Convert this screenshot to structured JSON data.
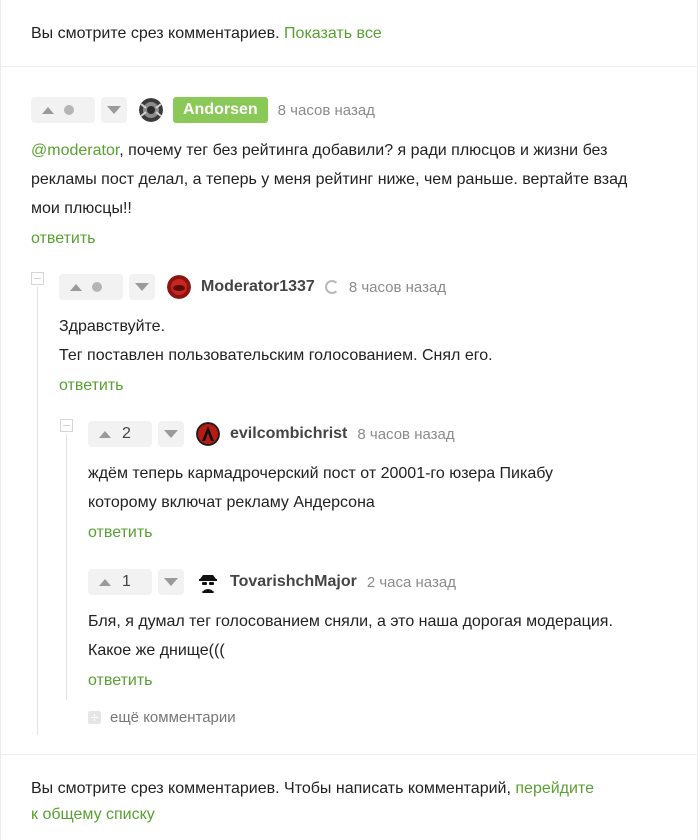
{
  "top_banner": {
    "text": "Вы смотрите срез комментариев.",
    "link": "Показать все"
  },
  "comments": [
    {
      "vote_count": "",
      "username": "Andorsen",
      "time": "8 часов назад",
      "mention": "@moderator",
      "lines": [
        ", почему тег без рейтинга добавили? я ради плюсцов и жизни без",
        "рекламы пост делал, а теперь у меня рейтинг ниже, чем раньше. вертайте взад",
        "мои плюсцы!!"
      ],
      "reply": "ответить"
    },
    {
      "vote_count": "",
      "username": "Moderator1337",
      "time": "8 часов назад",
      "lines": [
        "Здравствуйте.",
        "Тег поставлен пользовательским голосованием. Снял его."
      ],
      "reply": "ответить"
    },
    {
      "vote_count": "2",
      "username": "evilcombichrist",
      "time": "8 часов назад",
      "lines": [
        "ждём теперь кармадрочерский пост от 20001-го юзера Пикабу",
        "которому включат рекламу Андерсона"
      ],
      "reply": "ответить"
    },
    {
      "vote_count": "1",
      "username": "TovarishchMajor",
      "time": "2 часа назад",
      "lines": [
        "Бля, я думал тег голосованием сняли, а это наша дорогая модерация.",
        "Какое же днище((("
      ],
      "reply": "ответить"
    }
  ],
  "more_comments": "ещё комментарии",
  "bottom_banner": {
    "text": "Вы смотрите срез комментариев. Чтобы написать комментарий,",
    "link_line1": "перейдите",
    "link_line2": "к общему списку"
  },
  "colors": {
    "accent_green": "#59a032",
    "badge_green": "#8ac858"
  },
  "icons": [
    "upvote-icon",
    "downvote-icon",
    "moderator-icon",
    "collapse-icon",
    "expand-icon"
  ]
}
